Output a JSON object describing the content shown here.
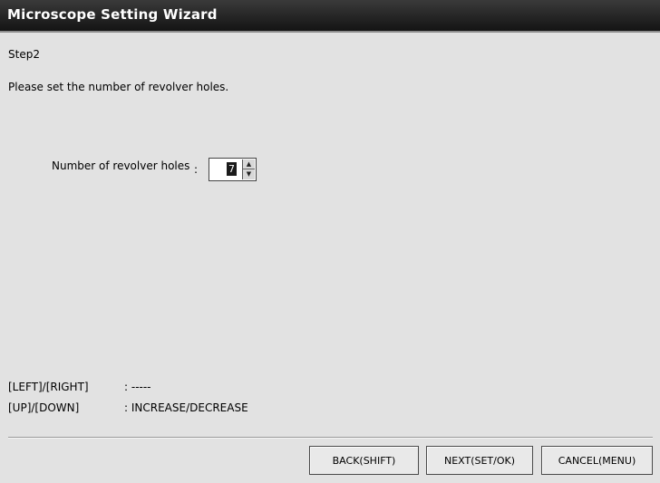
{
  "window": {
    "title": "Microscope Setting Wizard"
  },
  "step": "Step2",
  "instruction": "Please set the number of revolver holes.",
  "field": {
    "label": "Number of revolver holes",
    "colon": ":",
    "value": "7",
    "up_glyph": "▲",
    "down_glyph": "▼"
  },
  "hints": [
    {
      "key": "[LEFT]/[RIGHT]",
      "action": ": -----"
    },
    {
      "key": "[UP]/[DOWN]",
      "action": ": INCREASE/DECREASE"
    }
  ],
  "buttons": {
    "back": "BACK(SHIFT)",
    "next": "NEXT(SET/OK)",
    "cancel": "CANCEL(MENU)"
  }
}
